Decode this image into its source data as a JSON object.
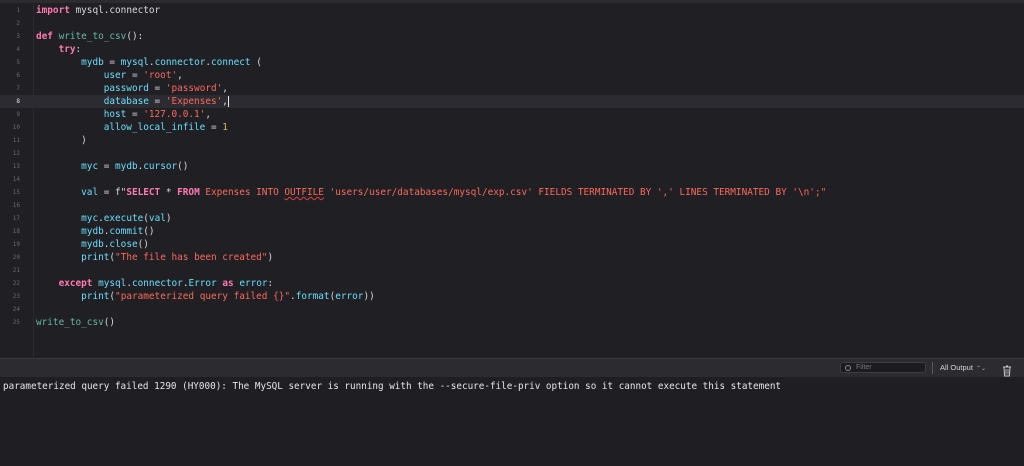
{
  "editor": {
    "current_line": 8,
    "lines": [
      {
        "n": "1",
        "tokens": [
          [
            "kw",
            "import"
          ],
          [
            "plain",
            " mysql.connector"
          ]
        ]
      },
      {
        "n": "2",
        "tokens": []
      },
      {
        "n": "3",
        "tokens": [
          [
            "kw",
            "def"
          ],
          [
            "plain",
            " "
          ],
          [
            "fn",
            "write_to_csv"
          ],
          [
            "plain",
            "():"
          ]
        ]
      },
      {
        "n": "4",
        "tokens": [
          [
            "plain",
            "    "
          ],
          [
            "kw",
            "try"
          ],
          [
            "plain",
            ":"
          ]
        ]
      },
      {
        "n": "5",
        "tokens": [
          [
            "plain",
            "        "
          ],
          [
            "id",
            "mydb"
          ],
          [
            "plain",
            " = "
          ],
          [
            "id",
            "mysql"
          ],
          [
            "plain",
            "."
          ],
          [
            "id",
            "connector"
          ],
          [
            "plain",
            "."
          ],
          [
            "id",
            "connect"
          ],
          [
            "plain",
            " ("
          ]
        ]
      },
      {
        "n": "6",
        "tokens": [
          [
            "plain",
            "            "
          ],
          [
            "id",
            "user"
          ],
          [
            "plain",
            " = "
          ],
          [
            "str",
            "'root'"
          ],
          [
            "plain",
            ","
          ]
        ]
      },
      {
        "n": "7",
        "tokens": [
          [
            "plain",
            "            "
          ],
          [
            "id",
            "password"
          ],
          [
            "plain",
            " = "
          ],
          [
            "str",
            "'password'"
          ],
          [
            "plain",
            ","
          ]
        ]
      },
      {
        "n": "8",
        "tokens": [
          [
            "plain",
            "            "
          ],
          [
            "id",
            "database"
          ],
          [
            "plain",
            " = "
          ],
          [
            "str",
            "'Expenses'"
          ],
          [
            "plain",
            ","
          ]
        ]
      },
      {
        "n": "9",
        "tokens": [
          [
            "plain",
            "            "
          ],
          [
            "id",
            "host"
          ],
          [
            "plain",
            " = "
          ],
          [
            "str",
            "'127.0.0.1'"
          ],
          [
            "plain",
            ","
          ]
        ]
      },
      {
        "n": "10",
        "tokens": [
          [
            "plain",
            "            "
          ],
          [
            "id",
            "allow_local_infile"
          ],
          [
            "plain",
            " = "
          ],
          [
            "num",
            "1"
          ]
        ]
      },
      {
        "n": "11",
        "tokens": [
          [
            "plain",
            "        )"
          ]
        ]
      },
      {
        "n": "12",
        "tokens": []
      },
      {
        "n": "13",
        "tokens": [
          [
            "plain",
            "        "
          ],
          [
            "id",
            "myc"
          ],
          [
            "plain",
            " = "
          ],
          [
            "id",
            "mydb"
          ],
          [
            "plain",
            "."
          ],
          [
            "id",
            "cursor"
          ],
          [
            "plain",
            "()"
          ]
        ]
      },
      {
        "n": "14",
        "tokens": []
      },
      {
        "n": "15",
        "tokens": [
          [
            "plain",
            "        "
          ],
          [
            "id",
            "val"
          ],
          [
            "plain",
            " = "
          ],
          [
            "plain",
            "f\""
          ],
          [
            "sqlkw",
            "SELECT"
          ],
          [
            "plain",
            " * "
          ],
          [
            "sqlkw",
            "FROM"
          ],
          [
            "str",
            " Expenses INTO "
          ],
          [
            "squig",
            "OUTFILE"
          ],
          [
            "str",
            " 'users/user/databases/mysql/exp.csv' FIELDS TERMINATED BY ',' LINES TERMINATED BY '\\n';\""
          ]
        ]
      },
      {
        "n": "16",
        "tokens": []
      },
      {
        "n": "17",
        "tokens": [
          [
            "plain",
            "        "
          ],
          [
            "id",
            "myc"
          ],
          [
            "plain",
            "."
          ],
          [
            "id",
            "execute"
          ],
          [
            "plain",
            "("
          ],
          [
            "id",
            "val"
          ],
          [
            "plain",
            ")"
          ]
        ]
      },
      {
        "n": "18",
        "tokens": [
          [
            "plain",
            "        "
          ],
          [
            "id",
            "mydb"
          ],
          [
            "plain",
            "."
          ],
          [
            "id",
            "commit"
          ],
          [
            "plain",
            "()"
          ]
        ]
      },
      {
        "n": "19",
        "tokens": [
          [
            "plain",
            "        "
          ],
          [
            "id",
            "mydb"
          ],
          [
            "plain",
            "."
          ],
          [
            "id",
            "close"
          ],
          [
            "plain",
            "()"
          ]
        ]
      },
      {
        "n": "20",
        "tokens": [
          [
            "plain",
            "        "
          ],
          [
            "id",
            "print"
          ],
          [
            "plain",
            "("
          ],
          [
            "str",
            "\"The file has been created\""
          ],
          [
            "plain",
            ")"
          ]
        ]
      },
      {
        "n": "21",
        "tokens": []
      },
      {
        "n": "22",
        "tokens": [
          [
            "plain",
            "    "
          ],
          [
            "kw",
            "except"
          ],
          [
            "plain",
            " "
          ],
          [
            "id",
            "mysql"
          ],
          [
            "plain",
            "."
          ],
          [
            "id",
            "connector"
          ],
          [
            "plain",
            "."
          ],
          [
            "id",
            "Error"
          ],
          [
            "plain",
            " "
          ],
          [
            "kw",
            "as"
          ],
          [
            "plain",
            " "
          ],
          [
            "id",
            "error"
          ],
          [
            "plain",
            ":"
          ]
        ]
      },
      {
        "n": "23",
        "tokens": [
          [
            "plain",
            "        "
          ],
          [
            "id",
            "print"
          ],
          [
            "plain",
            "("
          ],
          [
            "str",
            "\"parameterized query failed {}\""
          ],
          [
            "plain",
            "."
          ],
          [
            "id",
            "format"
          ],
          [
            "plain",
            "("
          ],
          [
            "id",
            "error"
          ],
          [
            "plain",
            "))"
          ]
        ]
      },
      {
        "n": "24",
        "tokens": []
      },
      {
        "n": "25",
        "tokens": [
          [
            "fn",
            "write_to_csv"
          ],
          [
            "plain",
            "()"
          ]
        ]
      }
    ]
  },
  "console_bar": {
    "filter_placeholder": "Filter",
    "output_selector": "All Output",
    "icons": [
      "filter-icon",
      "chevron-updown-icon",
      "trash-icon"
    ]
  },
  "console": {
    "output": "parameterized query failed 1290 (HY000): The MySQL server is running with the --secure-file-priv option so it cannot execute this statement"
  }
}
